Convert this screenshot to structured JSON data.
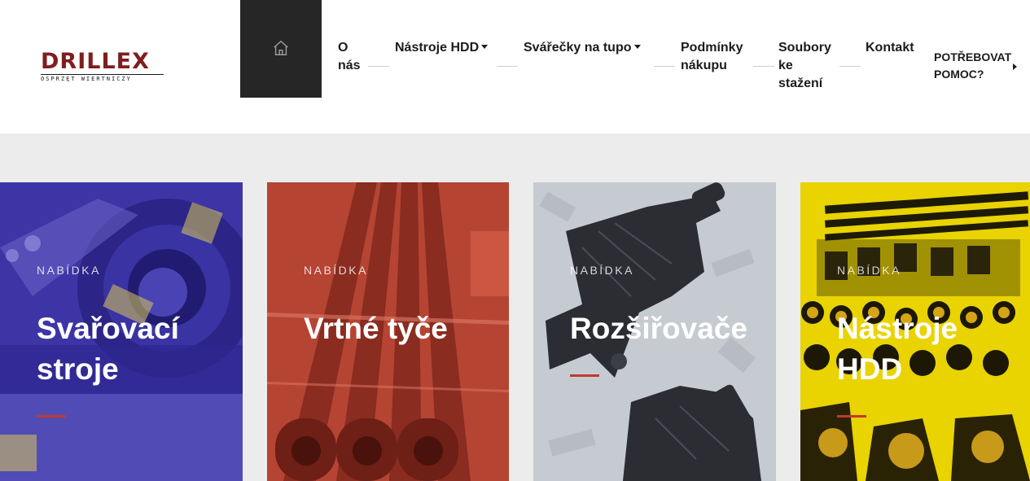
{
  "header": {
    "logo_word": "DRILLEX",
    "logo_tagline": "OSPRZĘT WIERTNICZY",
    "home_label": "home"
  },
  "nav": {
    "items": [
      {
        "line1": "O",
        "line2": "nás"
      },
      {
        "line1": "Nástroje HDD"
      },
      {
        "line1": "Svářečky na tupo"
      },
      {
        "line1": "Podmínky",
        "line2": "nákupu"
      },
      {
        "line1": "Soubory",
        "line2": "ke",
        "line3": "stažení"
      },
      {
        "line1": "Kontakt"
      }
    ],
    "help": {
      "line1": "POTŘEBOVAT",
      "line2": "POMOC?"
    }
  },
  "cards": [
    {
      "eyebrow": "NABÍDKA",
      "title_line1": "Svařovací",
      "title_line2": "stroje",
      "color": "#3c34a4"
    },
    {
      "eyebrow": "NABÍDKA",
      "title_line1": "Vrtné tyče",
      "color": "#b74534"
    },
    {
      "eyebrow": "NABÍDKA",
      "title_line1": "Rozšiřovače",
      "color": "#c4c8cf"
    },
    {
      "eyebrow": "NABÍDKA",
      "title_line1": "Nástroje",
      "title_line2": "HDD",
      "color": "#e8d200"
    }
  ],
  "colors": {
    "accent": "#c0392b",
    "brand": "#7e1e1e",
    "home_bg": "#262626",
    "band": "#ececec"
  }
}
